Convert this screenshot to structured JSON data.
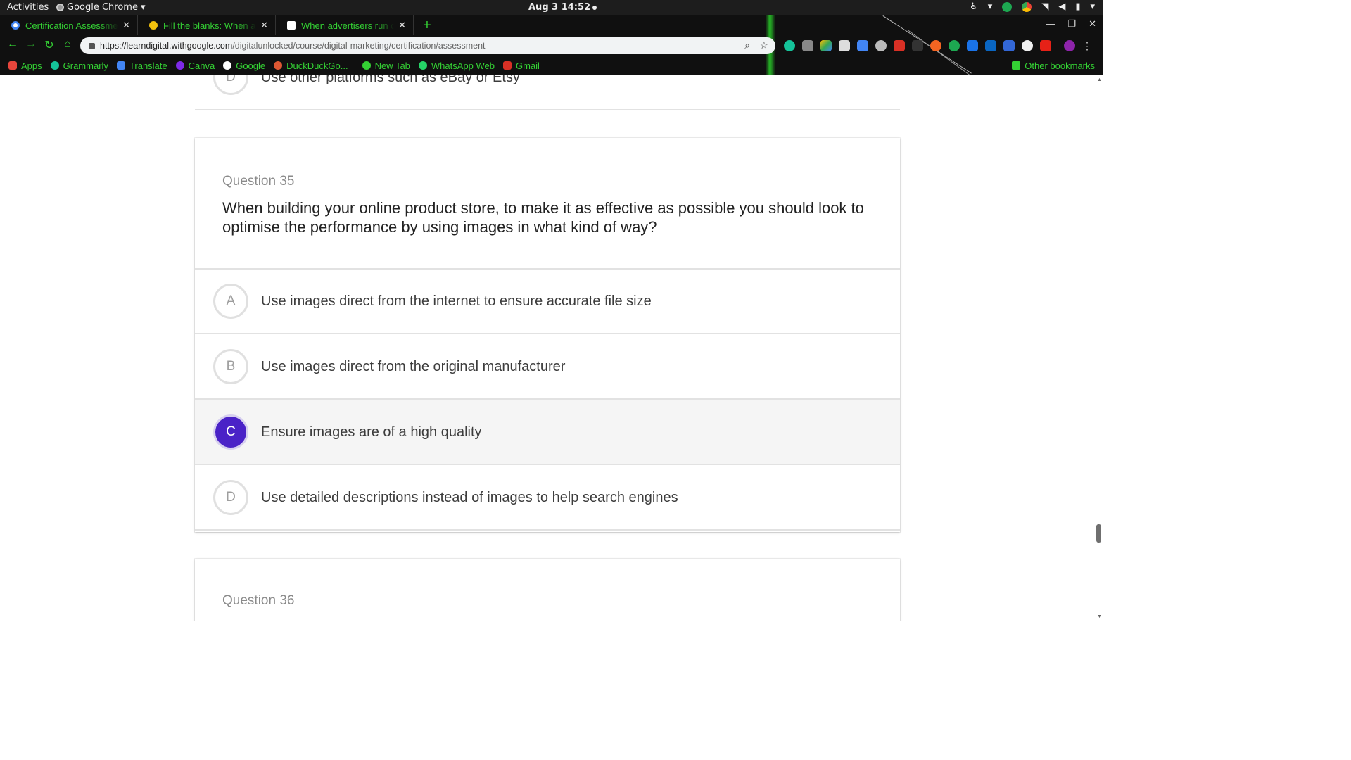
{
  "system": {
    "activities": "Activities",
    "app_name": "Google Chrome",
    "clock": "Aug 3  14:52"
  },
  "browser": {
    "tabs": [
      {
        "title": "Certification Assessment",
        "favicon_color": "#ffffff"
      },
      {
        "title": "Fill the blanks: When advertisers",
        "favicon_color": "#f4c20d"
      },
      {
        "title": "When advertisers run online",
        "favicon_color": "#ffffff"
      }
    ],
    "url_host": "https://learndigital.withgoogle.com",
    "url_path": "/digitalunlocked/course/digital-marketing/certification/assessment",
    "bookmarks": [
      {
        "label": "Apps",
        "color": "#e8453c"
      },
      {
        "label": "Grammarly",
        "color": "#15c39a"
      },
      {
        "label": "Translate",
        "color": "#4285f4"
      },
      {
        "label": "Canva",
        "color": "#7d2ae8"
      },
      {
        "label": "Google",
        "color": "#ffffff"
      },
      {
        "label": "DuckDuckGo...",
        "color": "#de5833"
      },
      {
        "label": "New Tab",
        "color": "#34d134"
      },
      {
        "label": "WhatsApp Web",
        "color": "#25d366"
      },
      {
        "label": "Gmail",
        "color": "#d93025"
      }
    ],
    "other_bookmarks": "Other bookmarks",
    "accent_color": "#34d134"
  },
  "assessment": {
    "prev_option": {
      "letter": "D",
      "text": "Use other platforms such as eBay or Etsy"
    },
    "question": {
      "number_label": "Question 35",
      "text": "When building your online product store, to make it as effective as possible you should look to optimise the performance by using images in what kind of way?",
      "options": [
        {
          "letter": "A",
          "text": "Use images direct from the internet to ensure accurate file size",
          "selected": false
        },
        {
          "letter": "B",
          "text": "Use images direct from the original manufacturer",
          "selected": false
        },
        {
          "letter": "C",
          "text": "Ensure images are of a high quality",
          "selected": true
        },
        {
          "letter": "D",
          "text": "Use detailed descriptions instead of images to help search engines",
          "selected": false
        }
      ]
    },
    "next_question": {
      "number_label": "Question 36"
    },
    "selected_color": "#4a22c7"
  }
}
